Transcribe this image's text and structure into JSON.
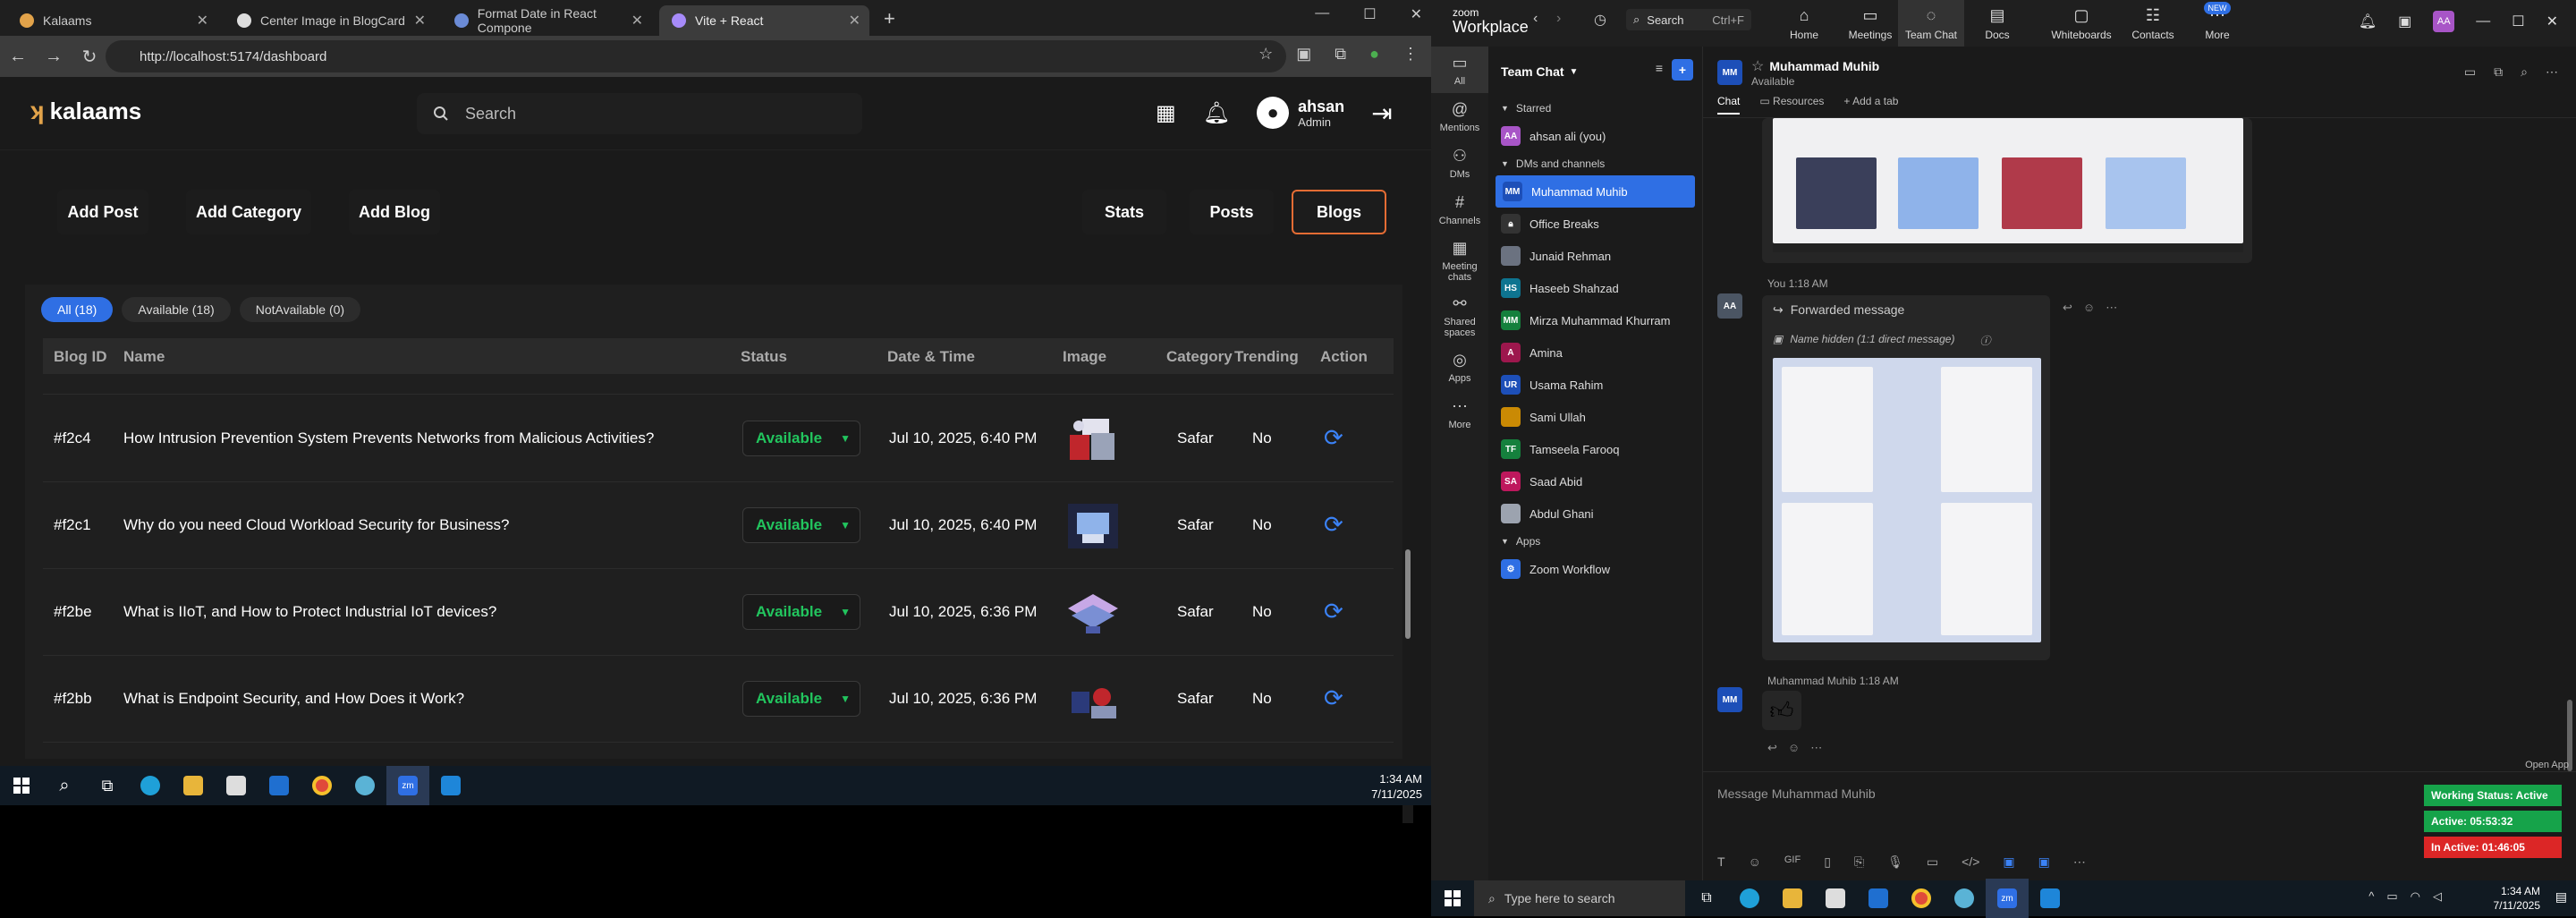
{
  "browser": {
    "tabs": [
      {
        "title": "Kalaams"
      },
      {
        "title": "Center Image in BlogCard"
      },
      {
        "title": "Format Date in React Compone"
      },
      {
        "title": "Vite + React"
      }
    ],
    "url": "http://localhost:5174/dashboard"
  },
  "app": {
    "logo_text": "kalaams",
    "search_placeholder": "Search",
    "user": {
      "name": "ahsan",
      "role": "Admin"
    },
    "actions": {
      "add_post": "Add Post",
      "add_category": "Add Category",
      "add_blog": "Add Blog",
      "stats": "Stats",
      "posts": "Posts",
      "blogs": "Blogs"
    },
    "filters": {
      "all": "All (18)",
      "available": "Available (18)",
      "not_available": "NotAvailable (0)"
    },
    "columns": {
      "id": "Blog ID",
      "name": "Name",
      "status": "Status",
      "datetime": "Date & Time",
      "image": "Image",
      "category": "Category",
      "trending": "Trending",
      "action": "Action"
    },
    "rows": [
      {
        "id": "#f2c4",
        "name": "How Intrusion Prevention System Prevents Networks from Malicious Activities?",
        "status": "Available",
        "datetime": "Jul 10, 2025, 6:40 PM",
        "category": "Safar",
        "trending": "No"
      },
      {
        "id": "#f2c1",
        "name": "Why do you need Cloud Workload Security for Business?",
        "status": "Available",
        "datetime": "Jul 10, 2025, 6:40 PM",
        "category": "Safar",
        "trending": "No"
      },
      {
        "id": "#f2be",
        "name": "What is IIoT, and How to Protect Industrial IoT devices?",
        "status": "Available",
        "datetime": "Jul 10, 2025, 6:36 PM",
        "category": "Safar",
        "trending": "No"
      },
      {
        "id": "#f2bb",
        "name": "What is Endpoint Security, and How Does it Work?",
        "status": "Available",
        "datetime": "Jul 10, 2025, 6:36 PM",
        "category": "Safar",
        "trending": "No"
      }
    ]
  },
  "taskbar_left": {
    "time": "1:34 AM",
    "date": "7/11/2025"
  },
  "zoom": {
    "brand_top": "zoom",
    "brand": "Workplace",
    "search": "Search",
    "search_shortcut": "Ctrl+F",
    "nav": {
      "home": "Home",
      "meetings": "Meetings",
      "team_chat": "Team Chat",
      "docs": "Docs",
      "whiteboards": "Whiteboards",
      "contacts": "Contacts",
      "more": "More",
      "new_badge": "NEW"
    },
    "rail": {
      "all": "All",
      "mentions": "Mentions",
      "dms": "DMs",
      "channels": "Channels",
      "meeting_chats": "Meeting chats",
      "shared_spaces": "Shared spaces",
      "apps": "Apps",
      "more": "More"
    },
    "list_title": "Team Chat",
    "sections": {
      "starred": "Starred",
      "dms": "DMs and channels",
      "apps": "Apps"
    },
    "contacts": [
      {
        "name": "ahsan ali (you)",
        "init": "AA"
      },
      {
        "name": "Muhammad Muhib",
        "init": "MM"
      },
      {
        "name": "Office Breaks",
        "init": ""
      },
      {
        "name": "Junaid Rehman",
        "init": ""
      },
      {
        "name": "Haseeb Shahzad",
        "init": "HS"
      },
      {
        "name": "Mirza Muhammad Khurram",
        "init": "MM"
      },
      {
        "name": "Amina",
        "init": "A"
      },
      {
        "name": "Usama Rahim",
        "init": "UR"
      },
      {
        "name": "Sami Ullah",
        "init": ""
      },
      {
        "name": "Tamseela Farooq",
        "init": "TF"
      },
      {
        "name": "Saad Abid",
        "init": "SA"
      },
      {
        "name": "Abdul Ghani",
        "init": ""
      },
      {
        "name": "Zoom Workflow",
        "init": ""
      }
    ],
    "chat": {
      "name": "Muhammad Muhib",
      "status": "Available",
      "tab_chat": "Chat",
      "tab_resources": "Resources",
      "add_tab": "Add a tab",
      "msg1_sender": "You 1:18 AM",
      "forwarded": "Forwarded message",
      "hidden": "Name hidden (1:1 direct message)",
      "msg2_sender": "Muhammad Muhib  1:18 AM",
      "input_placeholder": "Message Muhammad Muhib",
      "open_app": "Open App"
    },
    "status_widget": {
      "working": "Working Status: Active",
      "active": "Active: 05:53:32",
      "inactive": "In Active: 01:46:05"
    },
    "taskbar": {
      "search": "Type here to search",
      "time": "1:34 AM",
      "date": "7/11/2025"
    },
    "colors": {
      "accent": "#2f6fe4",
      "working": "#16a34a",
      "inactive": "#dc2626"
    }
  }
}
